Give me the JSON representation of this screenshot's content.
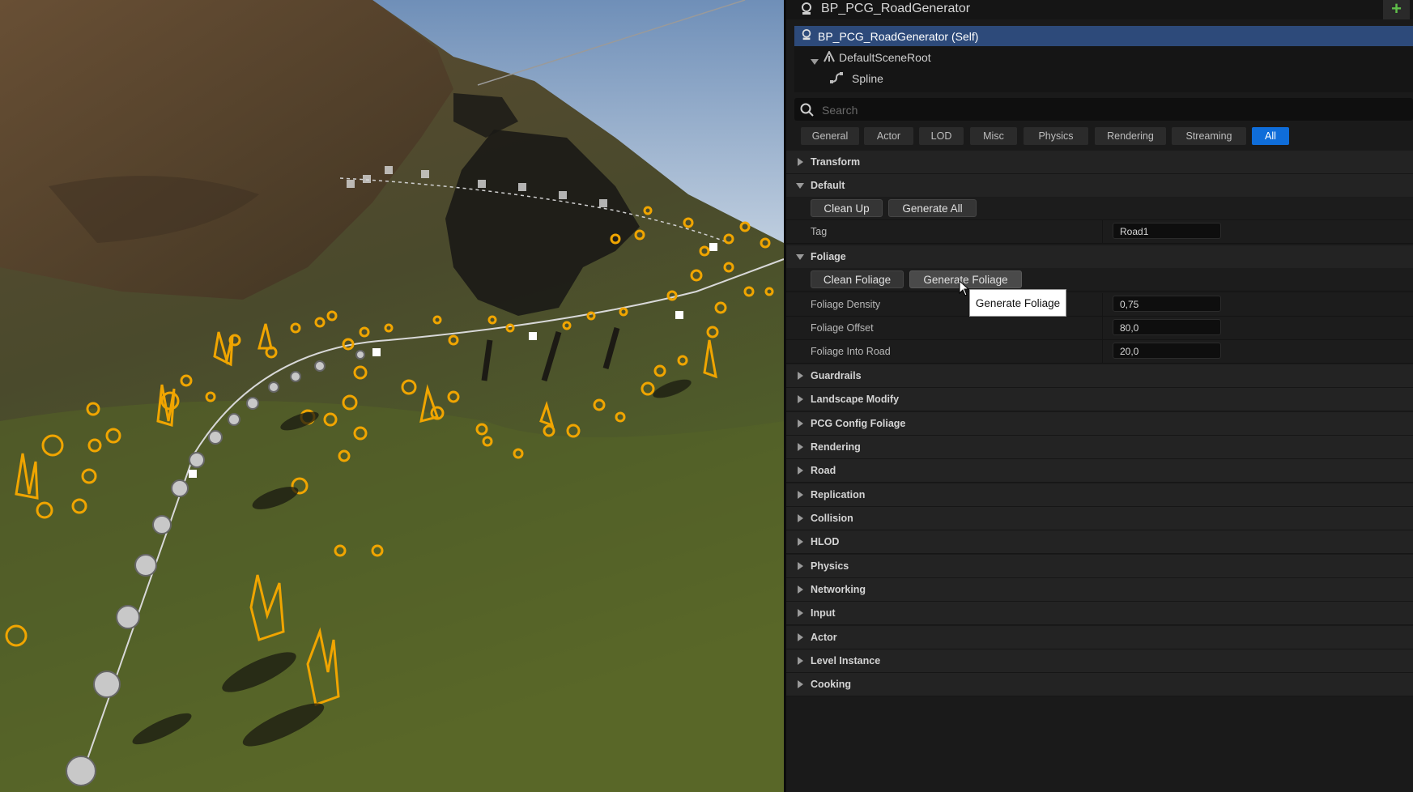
{
  "details": {
    "title": "BP_PCG_RoadGenerator",
    "add_label": "+",
    "components": [
      {
        "label": "BP_PCG_RoadGenerator (Self)",
        "icon": "blueprint-icon"
      },
      {
        "label": "DefaultSceneRoot",
        "icon": "scene-root-icon"
      },
      {
        "label": "Spline",
        "icon": "spline-icon"
      }
    ],
    "search_placeholder": "Search",
    "filters": [
      "General",
      "Actor",
      "LOD",
      "Misc",
      "Physics",
      "Rendering",
      "Streaming",
      "All"
    ],
    "active_filter": "All",
    "categories": {
      "transform": "Transform",
      "default": "Default",
      "foliage": "Foliage",
      "collapsed": [
        "Guardrails",
        "Landscape Modify",
        "PCG Config Foliage",
        "Rendering",
        "Road",
        "Replication",
        "Collision",
        "HLOD",
        "Physics",
        "Networking",
        "Input",
        "Actor",
        "Level Instance",
        "Cooking"
      ]
    },
    "default_section": {
      "clean_up": "Clean Up",
      "generate_all": "Generate All",
      "tag_label": "Tag",
      "tag_value": "Road1"
    },
    "foliage_section": {
      "clean_foliage": "Clean Foliage",
      "generate_foliage": "Generate Foliage",
      "tooltip": "Generate Foliage",
      "density_label": "Foliage Density",
      "density_value": "0,75",
      "offset_label": "Foliage Offset",
      "offset_value": "80,0",
      "into_road_label": "Foliage Into Road",
      "into_road_value": "20,0"
    }
  },
  "colors": {
    "selection": "#2d4a7a",
    "active_filter": "#0f6dd9",
    "foliage_outline": "#f0a500",
    "add_button": "#5fbf4a"
  }
}
